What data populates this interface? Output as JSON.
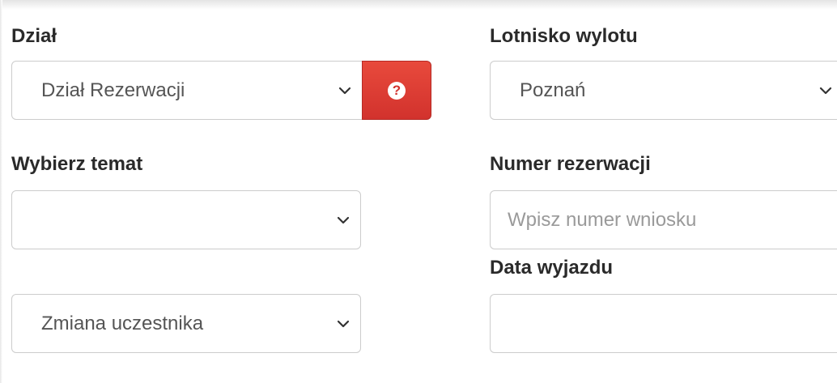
{
  "department": {
    "label": "Dział",
    "selected": "Dział Rezerwacji",
    "help_glyph": "?",
    "help_icon": "question-circle-icon",
    "help_button_color": "#d9352f"
  },
  "topic": {
    "label": "Wybierz temat",
    "selected": ""
  },
  "subtopic": {
    "selected": "Zmiana uczestnika"
  },
  "departure_airport": {
    "label": "Lotnisko wylotu",
    "selected": "Poznań"
  },
  "booking_number": {
    "label": "Numer rezerwacji",
    "value": "",
    "placeholder": "Wpisz numer wniosku"
  },
  "departure_date": {
    "label": "Data wyjazdu",
    "value": ""
  },
  "icons": {
    "dropdown": "chevron-down-icon"
  }
}
